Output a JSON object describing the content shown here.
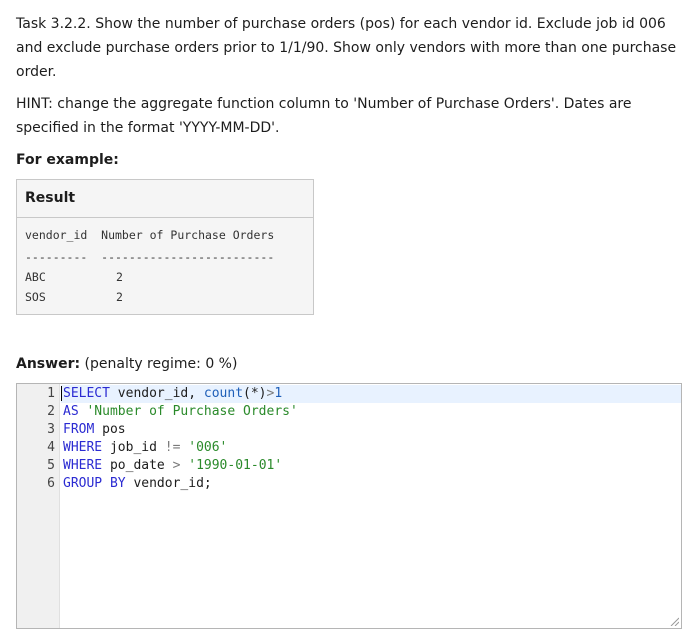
{
  "question": {
    "task_text": "Task 3.2.2. Show the number of purchase orders (pos) for each vendor id. Exclude job id 006 and exclude purchase orders prior to 1/1/90. Show only vendors with more than one purchase order.",
    "hint_text": "HINT: change the aggregate function column to 'Number of Purchase Orders'. Dates are specified in the format 'YYYY-MM-DD'.",
    "example_label": "For example:"
  },
  "result": {
    "title": "Result",
    "header_line": "vendor_id  Number of Purchase Orders",
    "divider_line": "---------  -------------------------",
    "rows": [
      {
        "vendor": "ABC",
        "count": "2"
      },
      {
        "vendor": "SOS",
        "count": "2"
      }
    ]
  },
  "answer": {
    "label": "Answer:",
    "penalty": "(penalty regime: 0 %)"
  },
  "editor": {
    "line_numbers": [
      "1",
      "2",
      "3",
      "4",
      "5",
      "6"
    ],
    "lines": [
      [
        {
          "t": "SELECT",
          "c": "kw"
        },
        {
          "t": " vendor_id, ",
          "c": ""
        },
        {
          "t": "count",
          "c": "fn"
        },
        {
          "t": "(*)",
          "c": ""
        },
        {
          "t": ">",
          "c": "op"
        },
        {
          "t": "1",
          "c": "fn"
        }
      ],
      [
        {
          "t": "AS",
          "c": "kw"
        },
        {
          "t": " ",
          "c": ""
        },
        {
          "t": "'Number of Purchase Orders'",
          "c": "str"
        }
      ],
      [
        {
          "t": "FROM",
          "c": "kw"
        },
        {
          "t": " pos",
          "c": ""
        }
      ],
      [
        {
          "t": "WHERE",
          "c": "kw"
        },
        {
          "t": " job_id ",
          "c": ""
        },
        {
          "t": "!=",
          "c": "op"
        },
        {
          "t": " ",
          "c": ""
        },
        {
          "t": "'006'",
          "c": "str"
        }
      ],
      [
        {
          "t": "WHERE",
          "c": "kw"
        },
        {
          "t": " po_date ",
          "c": ""
        },
        {
          "t": ">",
          "c": "op"
        },
        {
          "t": " ",
          "c": ""
        },
        {
          "t": "'1990-01-01'",
          "c": "str"
        }
      ],
      [
        {
          "t": "GROUP BY",
          "c": "kw"
        },
        {
          "t": " vendor_id;",
          "c": ""
        }
      ]
    ]
  }
}
